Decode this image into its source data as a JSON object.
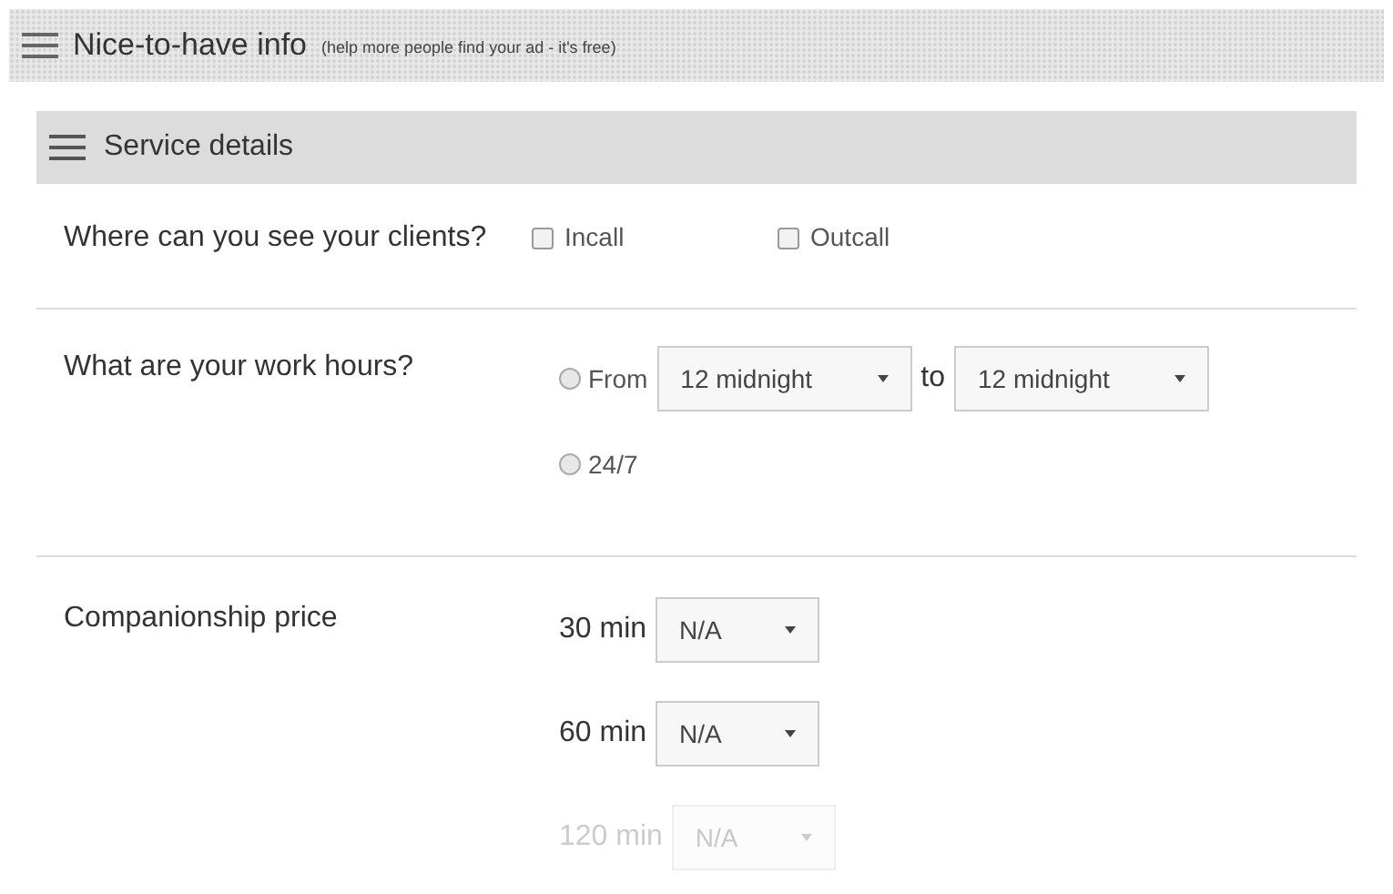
{
  "header": {
    "title": "Nice-to-have info",
    "subtitle": "(help more people find your ad - it's free)"
  },
  "section": {
    "title": "Service details"
  },
  "locations": {
    "label": "Where can you see your clients?",
    "options": [
      {
        "label": "Incall",
        "checked": false
      },
      {
        "label": "Outcall",
        "checked": false
      }
    ]
  },
  "work_hours": {
    "label": "What are your work hours?",
    "options": [
      {
        "kind": "range",
        "label": "From",
        "selected": false,
        "from": "12 midnight",
        "joiner": "to",
        "to": "12 midnight"
      },
      {
        "kind": "simple",
        "label": "24/7",
        "selected": false
      }
    ]
  },
  "prices": {
    "label": "Companionship price",
    "rows": [
      {
        "duration": "30 min",
        "value": "N/A",
        "disabled": false
      },
      {
        "duration": "60 min",
        "value": "N/A",
        "disabled": false
      },
      {
        "duration": "120 min",
        "value": "N/A",
        "disabled": true
      }
    ]
  }
}
